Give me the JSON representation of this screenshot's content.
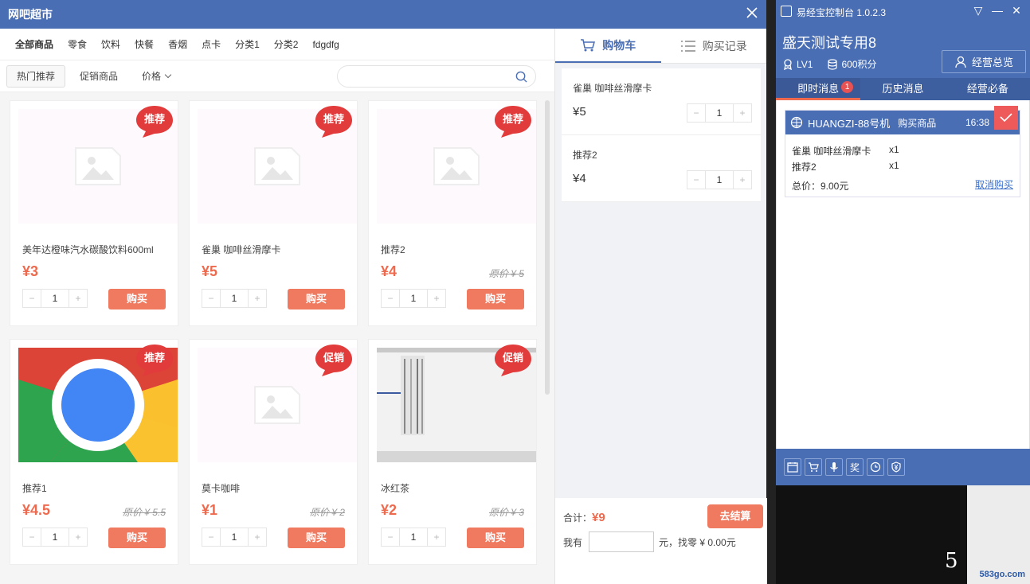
{
  "market": {
    "title": "网吧超市",
    "categories": [
      "全部商品",
      "零食",
      "饮料",
      "快餐",
      "香烟",
      "点卡",
      "分类1",
      "分类2",
      "fdgdfg"
    ],
    "filters": [
      "热门推荐",
      "促销商品",
      "价格"
    ],
    "search_placeholder": "",
    "buy_label": "购买",
    "products": [
      {
        "name": "美年达橙味汽水碳酸饮料600ml",
        "price": "¥3",
        "original": "",
        "qty": "1",
        "badge": "推荐"
      },
      {
        "name": "雀巢 咖啡丝滑摩卡",
        "price": "¥5",
        "original": "",
        "qty": "1",
        "badge": "推荐"
      },
      {
        "name": "推荐2",
        "price": "¥4",
        "original": "原价 ¥ 5",
        "qty": "1",
        "badge": "推荐"
      },
      {
        "name": "推荐1",
        "price": "¥4.5",
        "original": "原价 ¥ 5.5",
        "qty": "1",
        "badge": "推荐"
      },
      {
        "name": "莫卡咖啡",
        "price": "¥1",
        "original": "原价 ¥ 2",
        "qty": "1",
        "badge": "促销"
      },
      {
        "name": "冰红茶",
        "price": "¥2",
        "original": "原价 ¥ 3",
        "qty": "1",
        "badge": "促销"
      }
    ]
  },
  "cart": {
    "tab_cart": "购物车",
    "tab_history": "购买记录",
    "items": [
      {
        "name": "雀巢 咖啡丝滑摩卡",
        "price": "¥5",
        "qty": "1"
      },
      {
        "name": "推荐2",
        "price": "¥4",
        "qty": "1"
      }
    ],
    "total_label": "合计：",
    "total_value": "¥9",
    "checkout_label": "去结算",
    "pay_prefix": "我有",
    "pay_suffix": "元，找零 ¥  0.00元"
  },
  "console": {
    "title": "易经宝控制台 1.0.2.3",
    "user": "盛天测试专用8",
    "level": "LV1",
    "points": "600积分",
    "overview_label": "经营总览",
    "tabs": [
      {
        "label": "即时消息",
        "badge": "1"
      },
      {
        "label": "历史消息",
        "badge": ""
      },
      {
        "label": "经营必备",
        "badge": ""
      }
    ],
    "message": {
      "machine": "HUANGZI-88号机",
      "type": "购买商品",
      "time": "16:38",
      "lines": [
        {
          "name": "雀巢 咖啡丝滑摩卡",
          "qty": "x1"
        },
        {
          "name": "推荐2",
          "qty": "x1"
        }
      ],
      "total": "总价：9.00元",
      "cancel": "取消购买"
    },
    "footer_icons": [
      "calendar-icon",
      "cart-icon",
      "mic-icon",
      "award-icon",
      "clock-icon",
      "yen-shield-icon"
    ],
    "footer_award_glyph": "奖"
  },
  "watermark": "583go.com",
  "watermark_num": "5",
  "colors": {
    "brand": "#4a6eb4",
    "accent": "#ee6a4e",
    "badge_red": "#e23b3b"
  }
}
